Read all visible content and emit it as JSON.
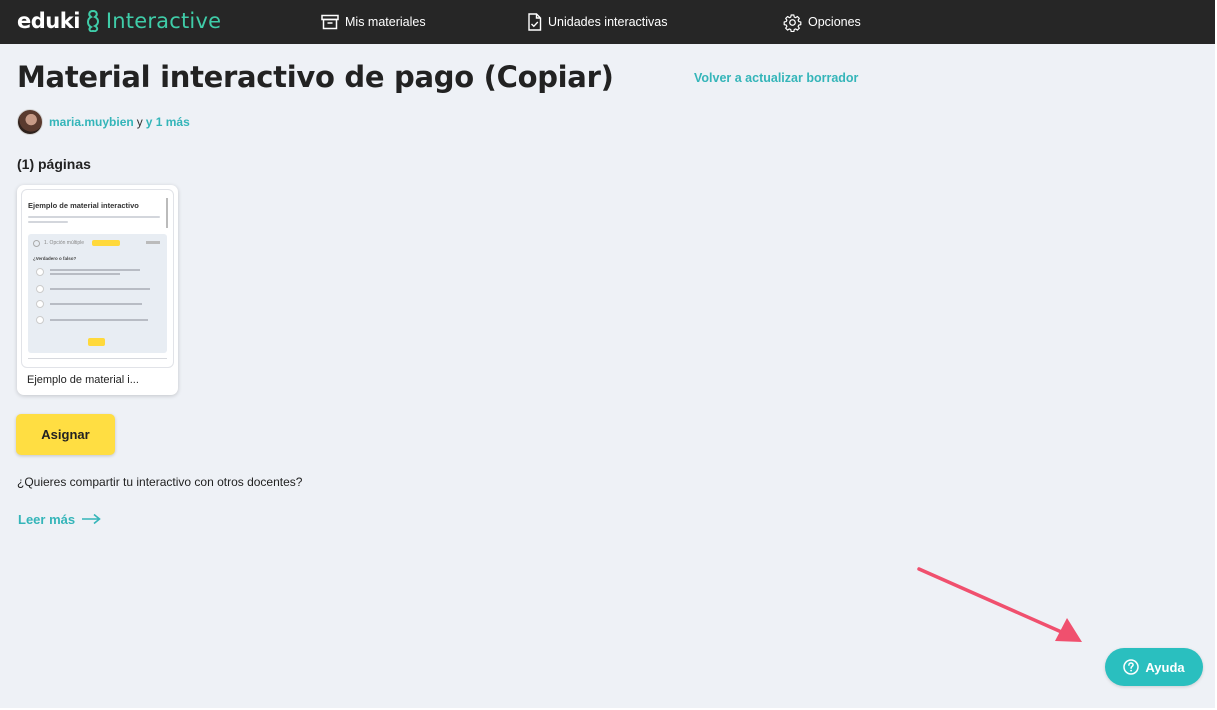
{
  "brand": {
    "name": "eduki",
    "product": "Interactive",
    "accent": "#3fcca8"
  },
  "nav": {
    "items": [
      {
        "label": "Mis materiales",
        "icon": "archive-box-icon"
      },
      {
        "label": "Unidades interactivas",
        "icon": "document-check-icon"
      },
      {
        "label": "Opciones",
        "icon": "gear-icon"
      }
    ]
  },
  "main": {
    "title": "Material interactivo de pago (Copiar)",
    "refresh_link": "Volver a actualizar borrador",
    "authors": {
      "primary": "maria.muybien",
      "connector": "y",
      "more": "y 1 más"
    },
    "pages_count_label": "(1) páginas",
    "card": {
      "preview_title": "Ejemplo de material interactivo",
      "preview_question_label": "1. Opción múltiple",
      "preview_question": "¿Verdadero o falso?",
      "label": "Ejemplo de material i..."
    },
    "assign_button": "Asignar",
    "share_question": "¿Quieres compartir tu interactivo con otros docentes?",
    "read_more": "Leer más"
  },
  "help_button": "Ayuda",
  "colors": {
    "topbar": "#262626",
    "link": "#34b5b9",
    "assign": "#ffde42",
    "help": "#2abfbf",
    "annotation_arrow": "#f0506e",
    "background": "#eef1f6"
  }
}
